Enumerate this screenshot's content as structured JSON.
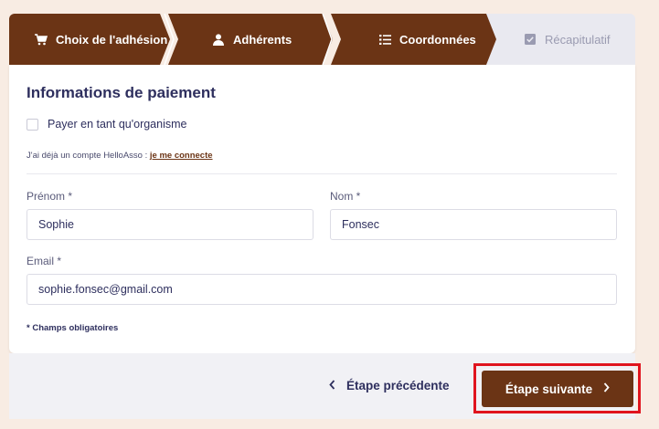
{
  "stepper": {
    "steps": [
      {
        "label": "Choix de l'adhésion",
        "icon": "cart-icon",
        "state": "done"
      },
      {
        "label": "Adhérents",
        "icon": "user-icon",
        "state": "done"
      },
      {
        "label": "Coordonnées",
        "icon": "list-icon",
        "state": "active"
      },
      {
        "label": "Récapitulatif",
        "icon": "check-square-icon",
        "state": "upcoming"
      }
    ]
  },
  "form": {
    "title": "Informations de paiement",
    "org_checkbox_label": "Payer en tant qu'organisme",
    "account_text": "J'ai déjà un compte HelloAsso : ",
    "account_link": "je me connecte",
    "firstname_label": "Prénom *",
    "firstname_value": "Sophie",
    "lastname_label": "Nom *",
    "lastname_value": "Fonsec",
    "email_label": "Email *",
    "email_value": "sophie.fonsec@gmail.com",
    "required_note": "* Champs obligatoires"
  },
  "footer": {
    "prev_label": "Étape précédente",
    "next_label": "Étape suivante"
  },
  "colors": {
    "brand": "#6b3415",
    "text": "#2e2f5e",
    "background": "#f8ece3",
    "highlight": "#e0141e"
  }
}
